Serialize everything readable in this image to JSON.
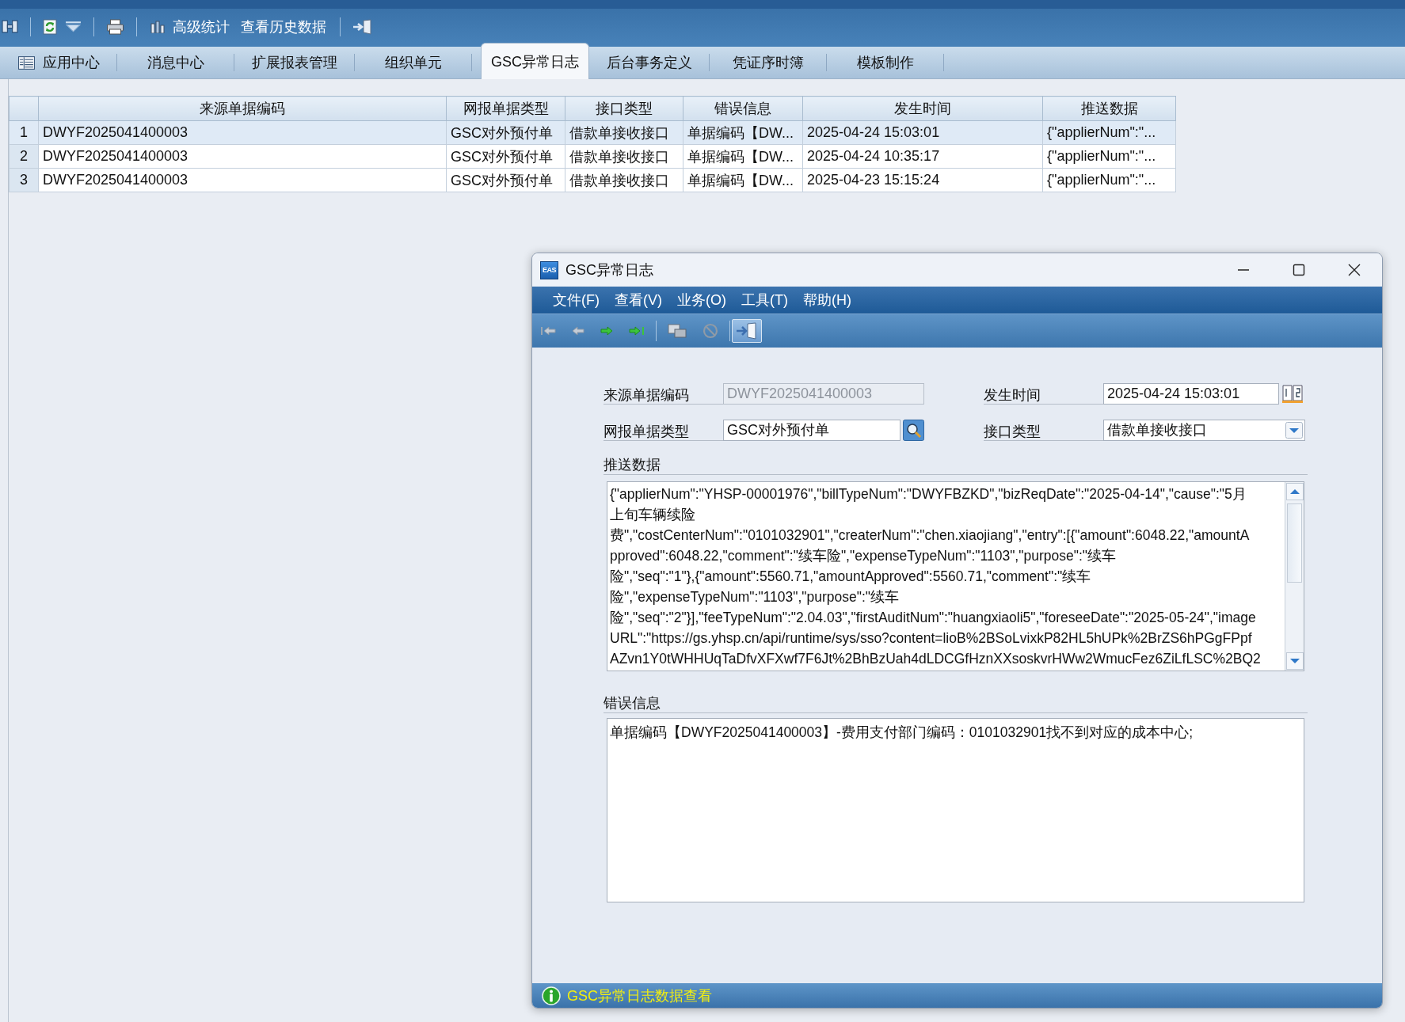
{
  "toolbar": {
    "buttons": [
      {
        "kind": "icon-text",
        "label": "高级统计"
      },
      {
        "kind": "text",
        "label": "查看历史数据"
      }
    ]
  },
  "tabs": [
    {
      "kind": "icon",
      "label": "应用中心",
      "selected": false
    },
    {
      "kind": "text",
      "label": "消息中心",
      "selected": false
    },
    {
      "kind": "text",
      "label": "扩展报表管理",
      "selected": false
    },
    {
      "kind": "text",
      "label": "组织单元",
      "selected": false
    },
    {
      "kind": "text",
      "label": "GSC异常日志",
      "selected": true
    },
    {
      "kind": "text",
      "label": "后台事务定义",
      "selected": false
    },
    {
      "kind": "text",
      "label": "凭证序时簿",
      "selected": false
    },
    {
      "kind": "text",
      "label": "模板制作",
      "selected": false
    }
  ],
  "table": {
    "columns": [
      "来源单据编码",
      "网报单据类型",
      "接口类型",
      "错误信息",
      "发生时间",
      "推送数据"
    ],
    "rows": [
      {
        "number": "1",
        "selected": true,
        "cells": [
          "DWYF2025041400003",
          "GSC对外预付单",
          "借款单接收接口",
          "单据编码【DW...",
          "2025-04-24 15:03:01",
          "{\"applierNum\":\"..."
        ]
      },
      {
        "number": "2",
        "selected": false,
        "cells": [
          "DWYF2025041400003",
          "GSC对外预付单",
          "借款单接收接口",
          "单据编码【DW...",
          "2025-04-24 10:35:17",
          "{\"applierNum\":\"..."
        ]
      },
      {
        "number": "3",
        "selected": false,
        "cells": [
          "DWYF2025041400003",
          "GSC对外预付单",
          "借款单接收接口",
          "单据编码【DW...",
          "2025-04-23 15:15:24",
          "{\"applierNum\":\"..."
        ]
      }
    ]
  },
  "dialog": {
    "logo": "EAS",
    "title": "GSC异常日志",
    "menu": [
      "文件(F)",
      "查看(V)",
      "业务(O)",
      "工具(T)",
      "帮助(H)"
    ],
    "fields": [
      {
        "kind": "text",
        "label": "来源单据编码",
        "value": "DWYF2025041400003",
        "disabled": true
      },
      {
        "kind": "date",
        "label": "发生时间",
        "value": "2025-04-24 15:03:01",
        "disabled": false
      },
      {
        "kind": "lookup",
        "label": "网报单据类型",
        "value": "GSC对外预付单",
        "disabled": false
      },
      {
        "kind": "select",
        "label": "接口类型",
        "value": "借款单接收接口",
        "disabled": false
      }
    ],
    "push_data": {
      "label": "推送数据",
      "lines": [
        "{\"applierNum\":\"YHSP-00001976\",\"billTypeNum\":\"DWYFBZKD\",\"bizReqDate\":\"2025-04-14\",\"cause\":\"5月",
        "上旬车辆续险",
        "费\",\"costCenterNum\":\"0101032901\",\"createrNum\":\"chen.xiaojiang\",\"entry\":[{\"amount\":6048.22,\"amountA",
        "pproved\":6048.22,\"comment\":\"续车险\",\"expenseTypeNum\":\"1103\",\"purpose\":\"续车",
        "险\",\"seq\":\"1\"},{\"amount\":5560.71,\"amountApproved\":5560.71,\"comment\":\"续车",
        "险\",\"expenseTypeNum\":\"1103\",\"purpose\":\"续车",
        "险\",\"seq\":\"2\"}],\"feeTypeNum\":\"2.04.03\",\"firstAuditNum\":\"huangxiaoli5\",\"foreseeDate\":\"2025-05-24\",\"image",
        "URL\":\"https://gs.yhsp.cn/api/runtime/sys/sso?content=lioB%2BSoLvixkP82HL5hUPk%2BrZS6hPGgFPpf",
        "AZvn1Y0tWHHUqTaDfvXFXwf7F6Jt%2BhBzUah4dLDCGfHznXXsoskvrHWw2WmucFez6ZiLfLSC%2BQ2"
      ]
    },
    "error_info": {
      "label": "错误信息",
      "value": "单据编码【DWYF2025041400003】-费用支付部门编码：0101032901找不到对应的成本中心;"
    },
    "status_bar": "GSC异常日志数据查看"
  }
}
